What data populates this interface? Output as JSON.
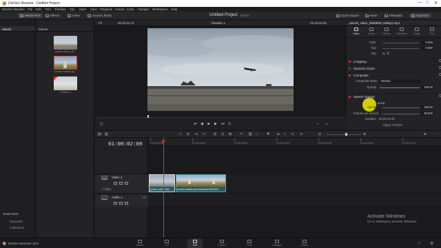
{
  "window": {
    "title": "DaVinci Resolve - Untitled Project",
    "controls": [
      "—",
      "□",
      "✕"
    ]
  },
  "menu": [
    "DaVinci Resolve",
    "File",
    "Edit",
    "Trim",
    "Timeline",
    "Clip",
    "Mark",
    "View",
    "Playback",
    "Fusion",
    "Color",
    "Fairlight",
    "Workspace",
    "Help"
  ],
  "toolbar": {
    "media_pool": "Media Pool",
    "effects": "Effects",
    "index": "Index",
    "sound_library": "Sound Library",
    "project_name": "Untitled Project",
    "project_status": "Edited",
    "quick_export": "Quick Export",
    "mixer": "Mixer",
    "metadata": "Metadata",
    "inspector": "Inspector"
  },
  "left_sidebar": {
    "master": "Master",
    "smart_bins": "Smart Bins",
    "keywords": "Keywords",
    "collections": "Collections"
  },
  "media_pool": {
    "header": "Master",
    "clips": [
      {
        "label": "pexels_video_26..."
      },
      {
        "label": "pexels.maksim-go..."
      },
      {
        "label": "Timeline 1"
      }
    ]
  },
  "viewer": {
    "zoom": "Fit",
    "source_tc": "00:00:11:13",
    "timeline_name": "Timeline 1",
    "timeline_tc": "01:00:02:09"
  },
  "inspector": {
    "clip_name": "pexels_video_2658998 (1080p).mp4",
    "tabs": [
      "Video",
      "Audio",
      "Effects",
      "Transition",
      "Image",
      "File"
    ],
    "rows": [
      {
        "label": "Pitch",
        "value": "0.000"
      },
      {
        "label": "Yaw",
        "value": "0.000"
      },
      {
        "label": "Flip",
        "value": ""
      }
    ],
    "sections": {
      "cropping": "Cropping",
      "dynamic_zoom": "Dynamic Zoom",
      "composite": "Composite",
      "composite_mode_label": "Composite Mode",
      "composite_mode_value": "Normal",
      "opacity_label": "Opacity",
      "opacity_value": "100.00",
      "speed_change": "Speed Change",
      "speed_label": "Speed %",
      "speed_value": "100.00",
      "frames_label": "Frames per second",
      "frames_value": "30.000",
      "duration_label": "Duration",
      "duration_value": "00:00:03:28",
      "ripple": "Ripple Timeline"
    }
  },
  "timeline": {
    "current_tc": "01:00:02:09",
    "ruler": [
      "01:00:00:00",
      "01:00:04:00",
      "01:00:08:00",
      "01:00:12:00",
      "01:00:16:00",
      "01:00:20:00",
      "01:00:24:00"
    ],
    "video_track": {
      "badge": "V1",
      "name": "Video 1",
      "clips": "2 Clips"
    },
    "audio_track": {
      "badge": "A1",
      "name": "Audio 1",
      "channels": "2.0"
    },
    "clip_a": "pexels_vide...265...",
    "clip_b": "pexels.maksim-goncharenok-5642523..."
  },
  "pages": [
    "Media",
    "Cut",
    "Edit",
    "Fusion",
    "Color",
    "Fairlight",
    "Deliver"
  ],
  "active_page": "Edit",
  "app_version": "DaVinci Resolve 18.5",
  "watermark": {
    "title": "Activate Windows",
    "subtitle": "Go to Settings to activate Windows."
  },
  "colors": {
    "accent_red": "#d33333",
    "clip_teal": "#2b5a60",
    "highlight_yellow": "#e8e000"
  }
}
